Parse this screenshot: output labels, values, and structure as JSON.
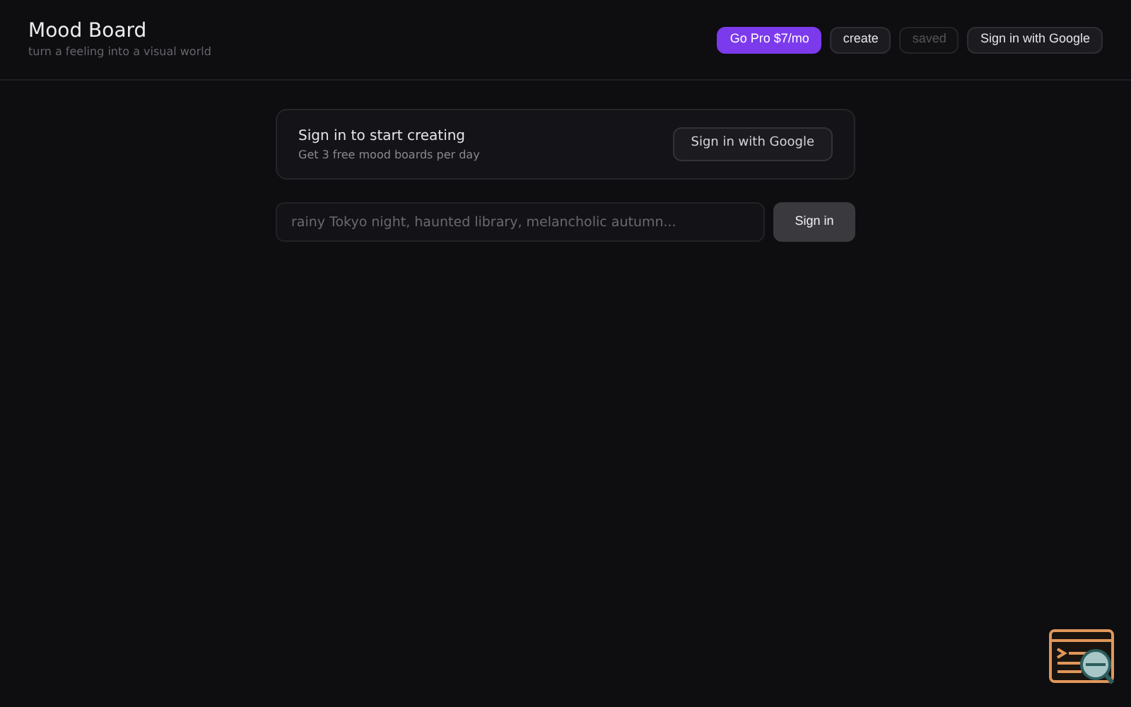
{
  "header": {
    "title": "Mood Board",
    "subtitle": "turn a feeling into a visual world"
  },
  "nav": [
    {
      "label": "Go Pro $7/mo",
      "kind": "primary",
      "disabled": false
    },
    {
      "label": "create",
      "kind": "plain",
      "disabled": false
    },
    {
      "label": "saved",
      "kind": "plain",
      "disabled": true
    },
    {
      "label": "Sign in with Google",
      "kind": "plain",
      "disabled": false
    }
  ],
  "signin_card": {
    "title": "Sign in to start creating",
    "subtitle": "Get 3 free mood boards per day",
    "button": "Sign in with Google"
  },
  "prompt": {
    "placeholder": "rainy Tokyo night, haunted library, melancholic autumn...",
    "button": "Sign in"
  }
}
